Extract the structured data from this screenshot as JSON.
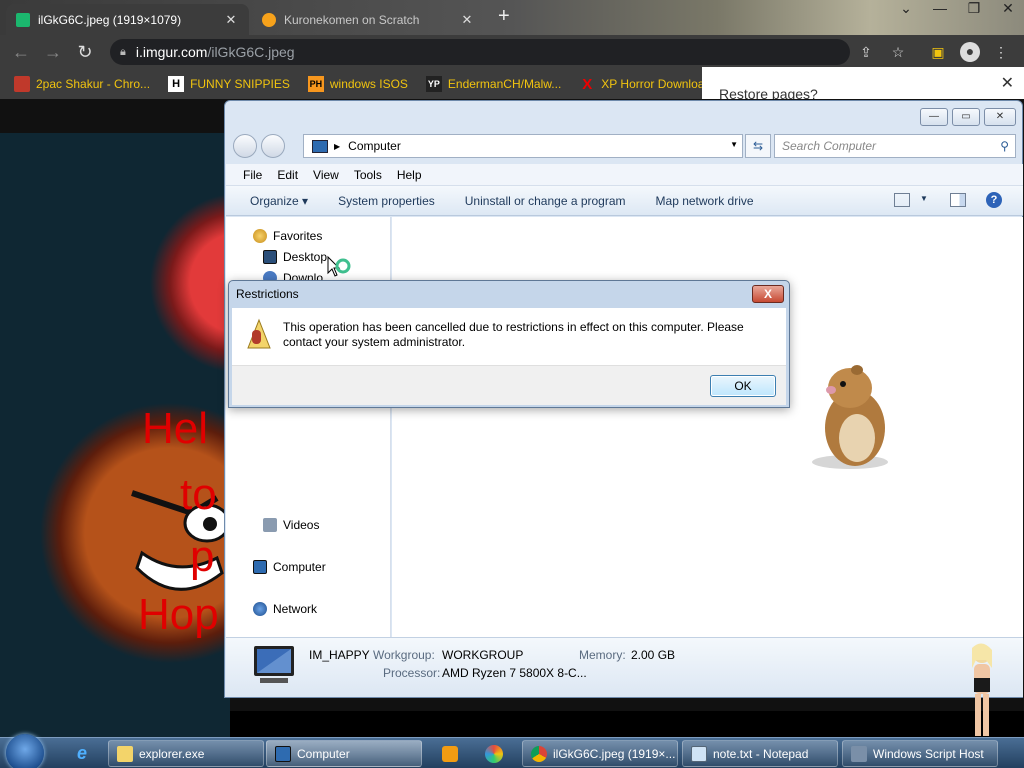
{
  "browser": {
    "tabs": [
      {
        "title": "ilGkG6C.jpeg (1919×1079)",
        "active": true
      },
      {
        "title": "Kuronekomen on Scratch",
        "active": false
      }
    ],
    "new_tab_icon": "plus-icon",
    "url_host": "i.imgur.com",
    "url_path": "/ilGkG6C.jpeg",
    "bookmarks": [
      {
        "label": "2pac Shakur - Chro...",
        "icon": "bookmark-icon-2pac"
      },
      {
        "label": "FUNNY SNIPPIES",
        "icon": "H"
      },
      {
        "label": "windows ISOS",
        "icon": "PH"
      },
      {
        "label": "EndermanCH/Malw...",
        "icon": "YP"
      },
      {
        "label": "XP Horror Download",
        "icon": "X"
      }
    ],
    "restore_popup_title": "Restore pages?",
    "bookmark_color": "#f1c40f"
  },
  "background_image": {
    "lines": [
      "Hel",
      "to",
      "p",
      "Hop"
    ]
  },
  "explorer": {
    "address": "Computer",
    "search_placeholder": "Search Computer",
    "menu": [
      "File",
      "Edit",
      "View",
      "Tools",
      "Help"
    ],
    "commands": [
      "Organize ▾",
      "System properties",
      "Uninstall or change a program",
      "Map network drive"
    ],
    "nav": {
      "favorites": "Favorites",
      "desktop": "Desktop",
      "downloads": "Downlo",
      "videos": "Videos",
      "computer": "Computer",
      "network": "Network"
    },
    "details": {
      "name": "IM_HAPPY",
      "workgroup_label": "Workgroup:",
      "workgroup_value": "WORKGROUP",
      "memory_label": "Memory:",
      "memory_value": "2.00 GB",
      "processor_label": "Processor:",
      "processor_value": "AMD Ryzen 7 5800X 8-C..."
    }
  },
  "dialog": {
    "title": "Restrictions",
    "message": "This operation has been cancelled due to restrictions in effect on this computer. Please contact your system administrator.",
    "ok_label": "OK",
    "close_label": "X"
  },
  "taskbar": {
    "items": [
      {
        "label": "explorer.exe"
      },
      {
        "label": "Computer"
      },
      {
        "label": "ilGkG6C.jpeg (1919×..."
      },
      {
        "label": "note.txt - Notepad"
      },
      {
        "label": "Windows Script Host"
      }
    ]
  }
}
